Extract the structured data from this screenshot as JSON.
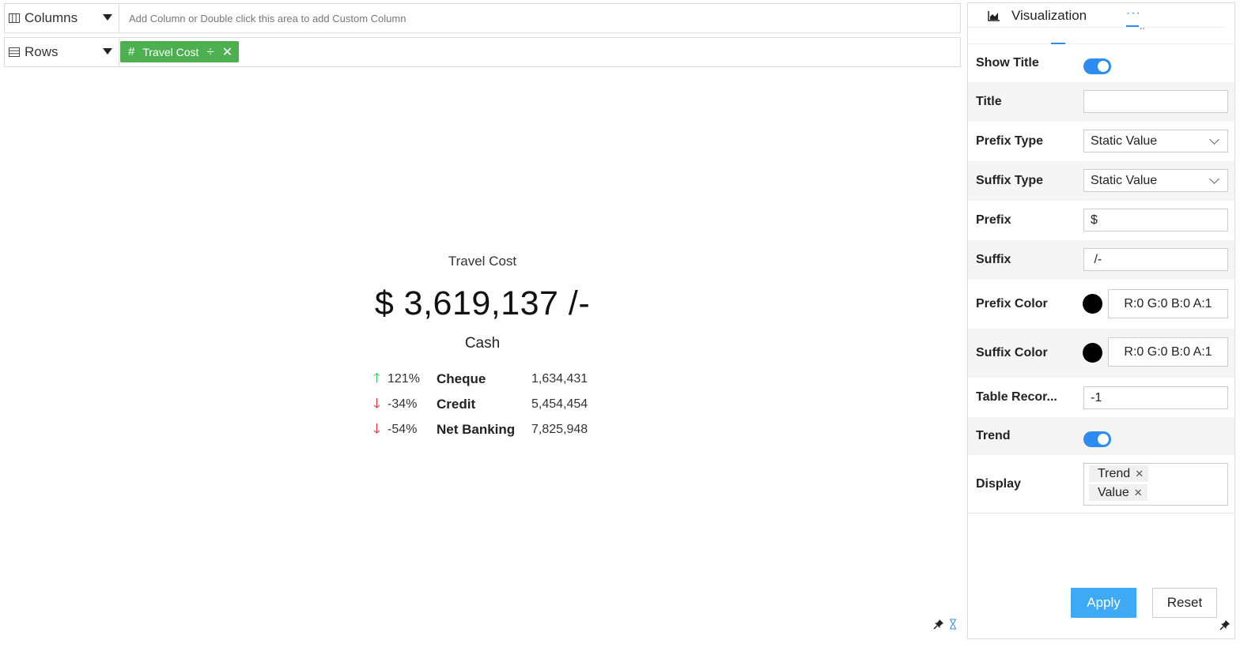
{
  "shelf": {
    "columns": {
      "label": "Columns",
      "placeholder": "Add Column or Double click this area to add Custom Column"
    },
    "rows": {
      "label": "Rows",
      "pill": {
        "hash": "#",
        "label": "Travel Cost",
        "divide": "÷",
        "close": "✕"
      }
    }
  },
  "kpi": {
    "title": "Travel Cost",
    "value": "$ 3,619,137 /-",
    "subtitle": "Cash",
    "trends": [
      {
        "arrow": "🡑",
        "direction": "up",
        "percent": "121%",
        "name": "Cheque",
        "value": "1,634,431"
      },
      {
        "arrow": "🡓",
        "direction": "down",
        "percent": "-34%",
        "name": "Credit",
        "value": "5,454,454"
      },
      {
        "arrow": "🡓",
        "direction": "down",
        "percent": "-54%",
        "name": "Net Banking",
        "value": "7,825,948"
      }
    ],
    "colors": {
      "up": "#22c55e",
      "down": "#e11d2a"
    }
  },
  "panel": {
    "tabs": {
      "visualization": "Visualization",
      "more": "···",
      "more_sub": ".."
    },
    "props": {
      "show_title": {
        "label": "Show Title",
        "on": true
      },
      "title": {
        "label": "Title",
        "value": ""
      },
      "prefix_type": {
        "label": "Prefix Type",
        "value": "Static Value"
      },
      "suffix_type": {
        "label": "Suffix Type",
        "value": "Static Value"
      },
      "prefix": {
        "label": "Prefix",
        "value": "$"
      },
      "suffix": {
        "label": "Suffix",
        "value": " /-"
      },
      "prefix_color": {
        "label": "Prefix Color",
        "value": "R:0 G:0 B:0 A:1",
        "swatch": "#000000"
      },
      "suffix_color": {
        "label": "Suffix Color",
        "value": "R:0 G:0 B:0 A:1",
        "swatch": "#000000"
      },
      "table_records": {
        "label": "Table Recor...",
        "value": "-1"
      },
      "trend": {
        "label": "Trend",
        "on": true
      },
      "display": {
        "label": "Display",
        "tags": [
          "Trend",
          "Value"
        ]
      }
    },
    "buttons": {
      "apply": "Apply",
      "reset": "Reset"
    },
    "accent": "#2d8cf0"
  }
}
